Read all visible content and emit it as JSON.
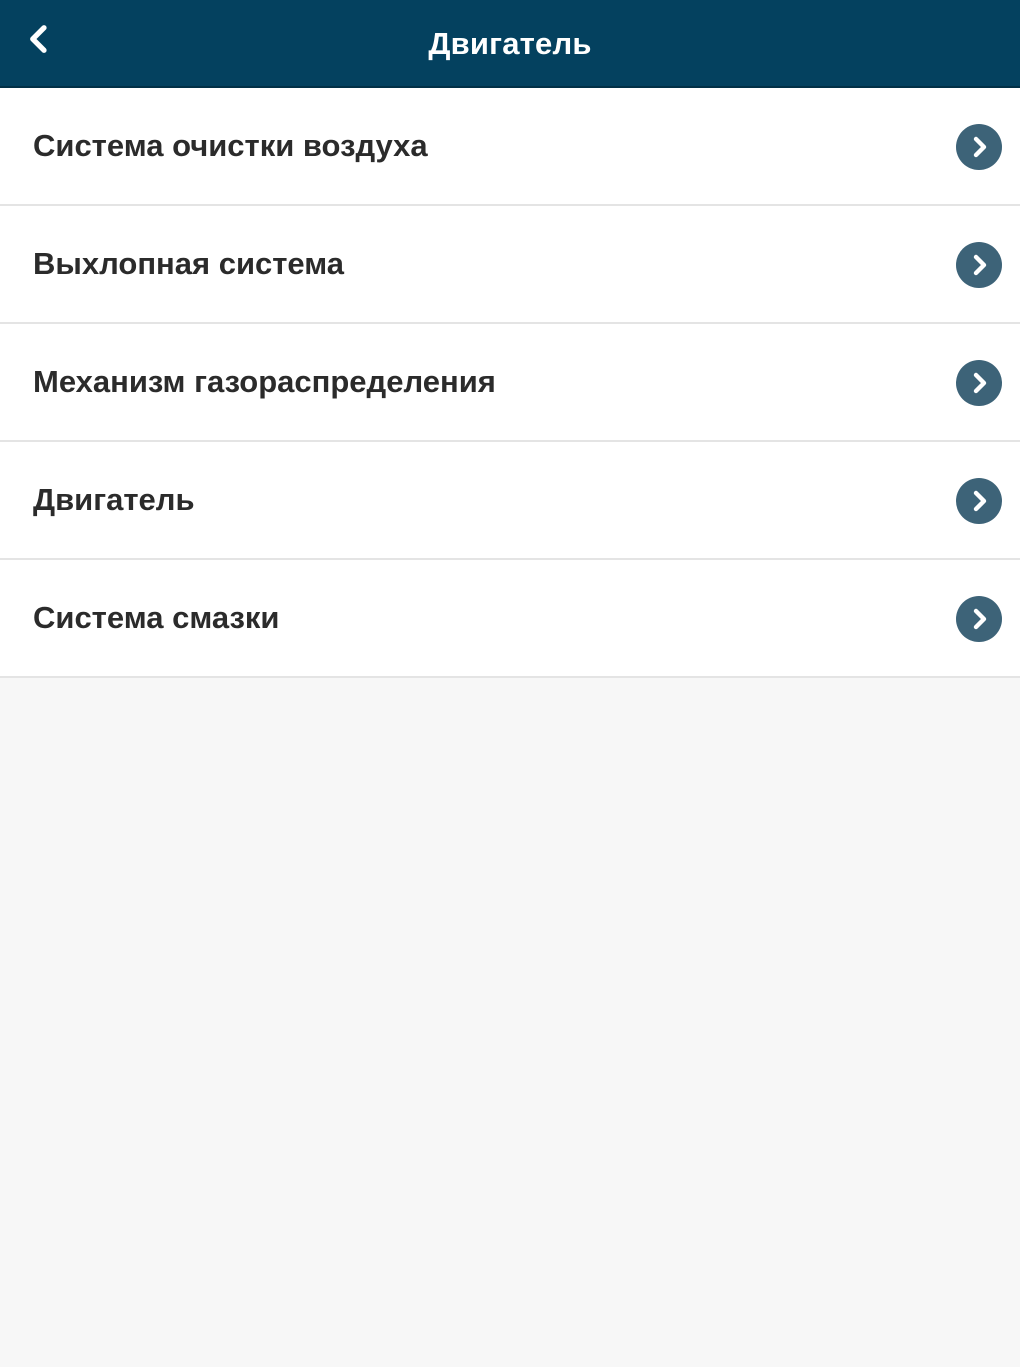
{
  "header": {
    "title": "Двигатель",
    "back_icon": "chevron-left-icon",
    "background_color": "#04415f"
  },
  "menu": {
    "items": [
      {
        "label": "Система очистки воздуха",
        "icon": "chevron-right-circle-icon"
      },
      {
        "label": "Выхлопная система",
        "icon": "chevron-right-circle-icon"
      },
      {
        "label": "Механизм газораспределения",
        "icon": "chevron-right-circle-icon"
      },
      {
        "label": "Двигатель",
        "icon": "chevron-right-circle-icon"
      },
      {
        "label": "Система смазки",
        "icon": "chevron-right-circle-icon"
      }
    ],
    "accent_color": "#3d6378"
  }
}
